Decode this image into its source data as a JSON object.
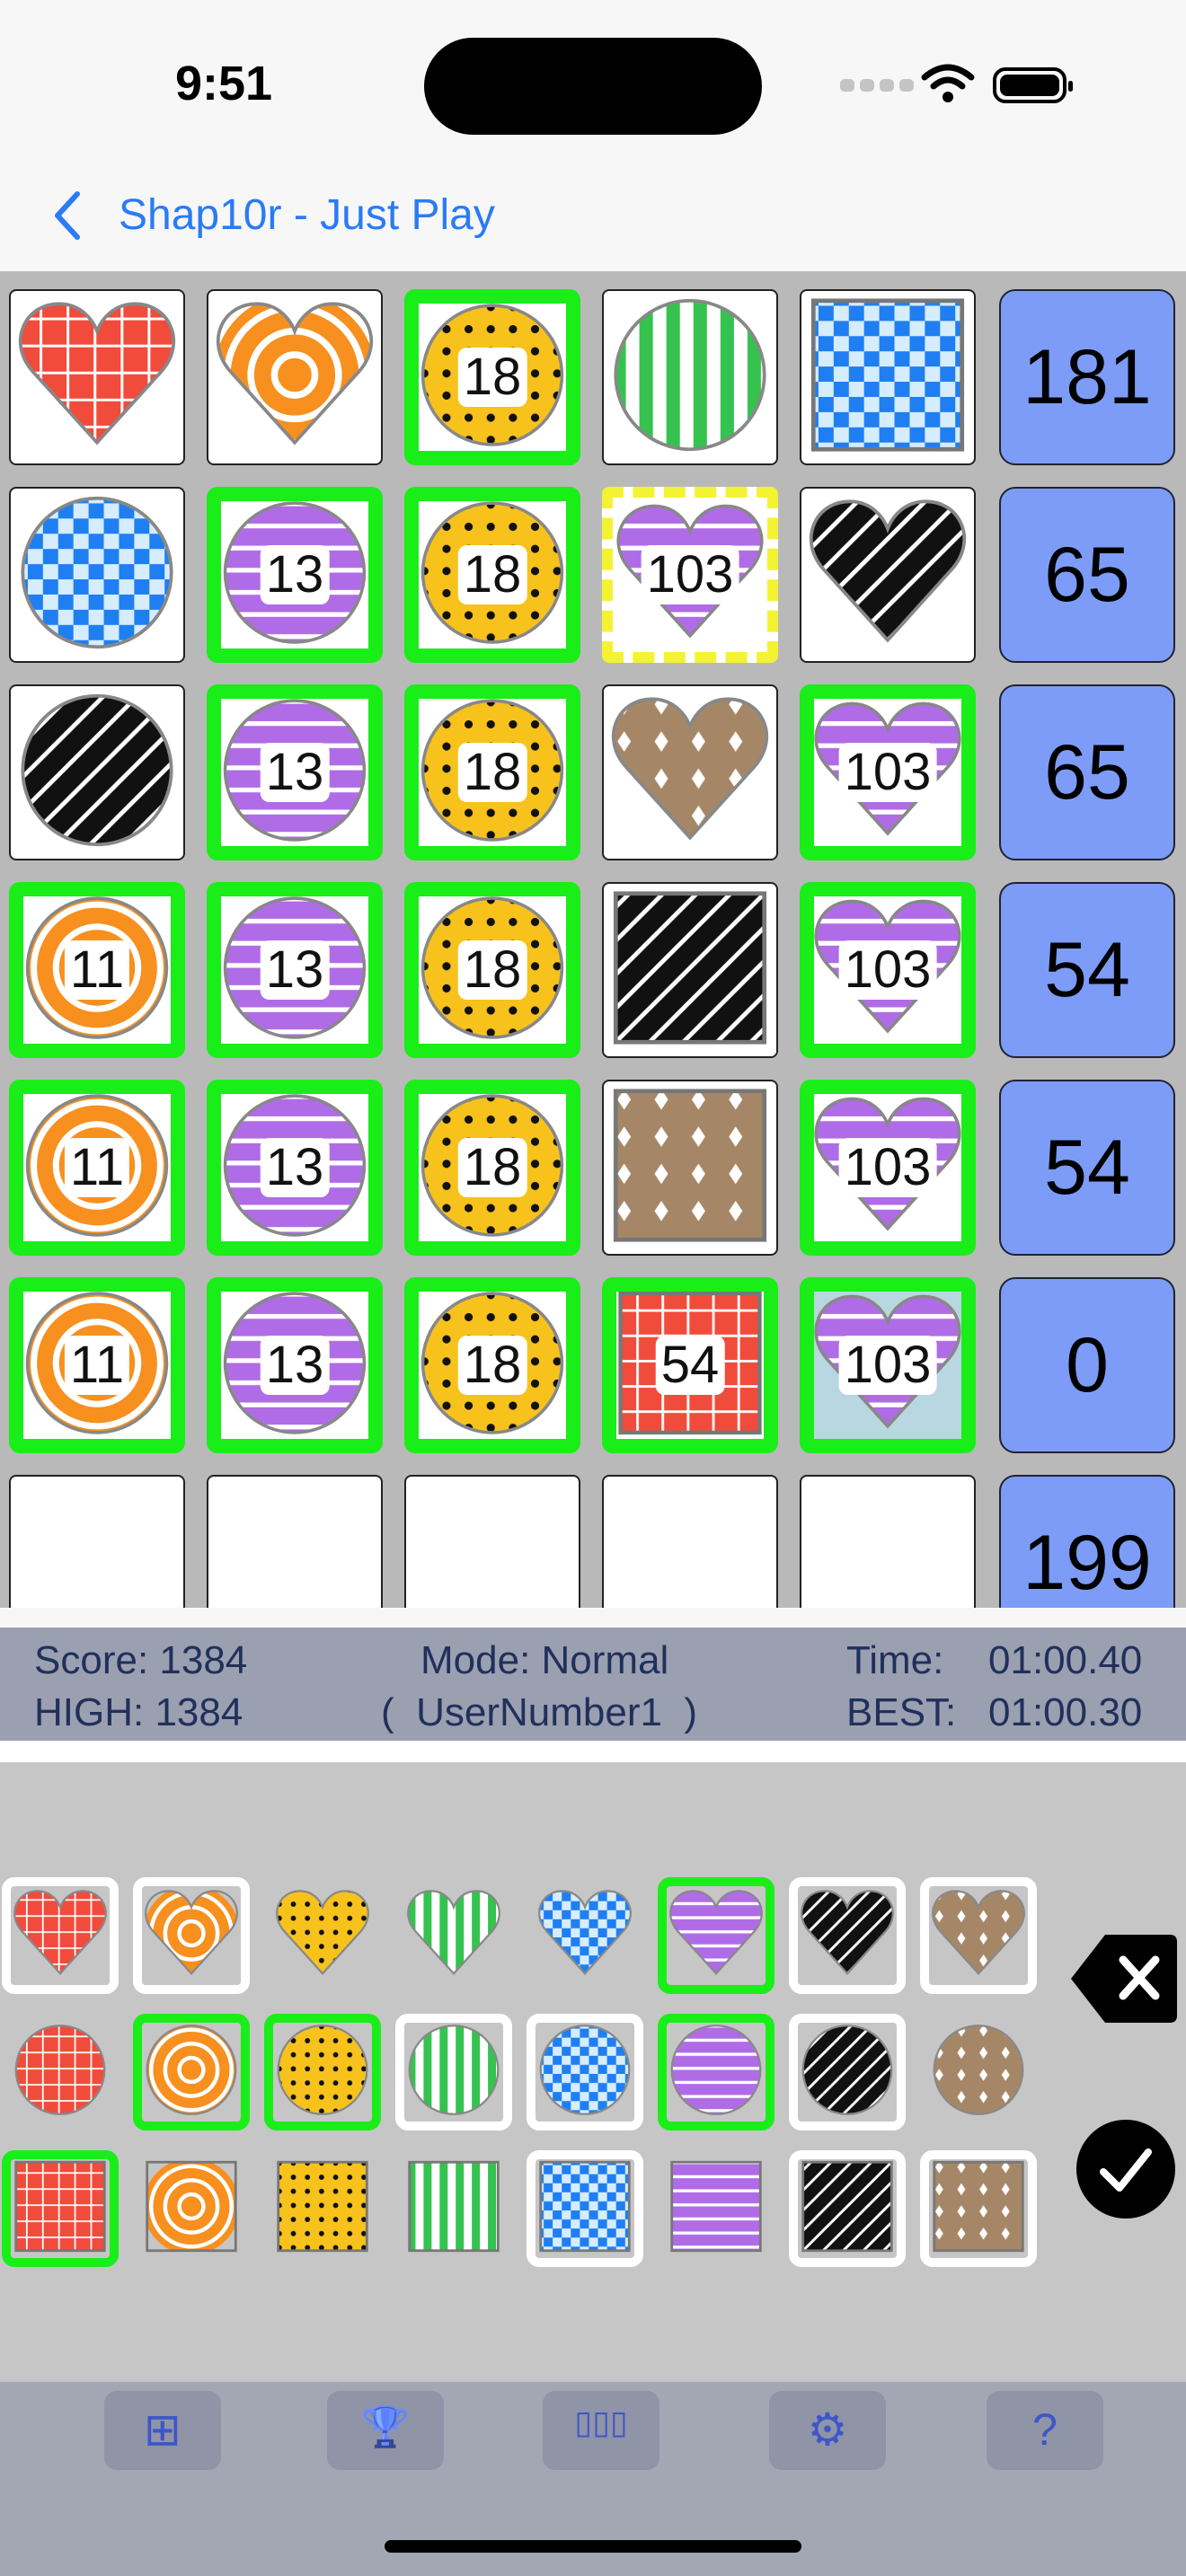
{
  "status_bar": {
    "time": "9:51",
    "icons": [
      "signal-icon",
      "wifi-icon",
      "battery-icon"
    ]
  },
  "nav": {
    "back_icon": "chevron-left-icon",
    "title": "Shap10r - Just Play"
  },
  "colors": {
    "red": "#f14b3c",
    "orange": "#f7901e",
    "yellow": "#f8c21c",
    "green": "#35c24f",
    "blue": "#1f7ff2",
    "purple": "#b06ce6",
    "black": "#111111",
    "brown": "#a58767",
    "highlight_green": "#19ee19",
    "highlight_yellow": "#f3f334",
    "sum_blue": "#7c9cf7"
  },
  "board": {
    "rows": [
      {
        "cells": [
          {
            "shape": "heart",
            "color": "red",
            "pattern": "grid"
          },
          {
            "shape": "heart",
            "color": "orange",
            "pattern": "rings"
          },
          {
            "shape": "circle",
            "color": "yellow",
            "pattern": "dots",
            "num": "18",
            "hl": "green"
          },
          {
            "shape": "circle",
            "color": "green",
            "pattern": "vstripes"
          },
          {
            "shape": "square",
            "color": "blue",
            "pattern": "checker"
          }
        ],
        "sum": "181"
      },
      {
        "cells": [
          {
            "shape": "circle",
            "color": "blue",
            "pattern": "checker"
          },
          {
            "shape": "circle",
            "color": "purple",
            "pattern": "hstripes",
            "num": "13",
            "hl": "green"
          },
          {
            "shape": "circle",
            "color": "yellow",
            "pattern": "dots",
            "num": "18",
            "hl": "green"
          },
          {
            "shape": "heart",
            "color": "purple",
            "pattern": "hstripes",
            "num": "103",
            "hl": "yellow"
          },
          {
            "shape": "heart",
            "color": "black",
            "pattern": "diag"
          }
        ],
        "sum": "65"
      },
      {
        "cells": [
          {
            "shape": "circle",
            "color": "black",
            "pattern": "diag"
          },
          {
            "shape": "circle",
            "color": "purple",
            "pattern": "hstripes",
            "num": "13",
            "hl": "green"
          },
          {
            "shape": "circle",
            "color": "yellow",
            "pattern": "dots",
            "num": "18",
            "hl": "green"
          },
          {
            "shape": "heart",
            "color": "brown",
            "pattern": "diamonds"
          },
          {
            "shape": "heart",
            "color": "purple",
            "pattern": "hstripes",
            "num": "103",
            "hl": "green"
          }
        ],
        "sum": "65"
      },
      {
        "cells": [
          {
            "shape": "circle",
            "color": "orange",
            "pattern": "rings",
            "num": "11",
            "hl": "green"
          },
          {
            "shape": "circle",
            "color": "purple",
            "pattern": "hstripes",
            "num": "13",
            "hl": "green"
          },
          {
            "shape": "circle",
            "color": "yellow",
            "pattern": "dots",
            "num": "18",
            "hl": "green"
          },
          {
            "shape": "square",
            "color": "black",
            "pattern": "diag"
          },
          {
            "shape": "heart",
            "color": "purple",
            "pattern": "hstripes",
            "num": "103",
            "hl": "green"
          }
        ],
        "sum": "54"
      },
      {
        "cells": [
          {
            "shape": "circle",
            "color": "orange",
            "pattern": "rings",
            "num": "11",
            "hl": "green"
          },
          {
            "shape": "circle",
            "color": "purple",
            "pattern": "hstripes",
            "num": "13",
            "hl": "green"
          },
          {
            "shape": "circle",
            "color": "yellow",
            "pattern": "dots",
            "num": "18",
            "hl": "green"
          },
          {
            "shape": "square",
            "color": "brown",
            "pattern": "diamonds"
          },
          {
            "shape": "heart",
            "color": "purple",
            "pattern": "hstripes",
            "num": "103",
            "hl": "green"
          }
        ],
        "sum": "54"
      },
      {
        "cells": [
          {
            "shape": "circle",
            "color": "orange",
            "pattern": "rings",
            "num": "11",
            "hl": "green"
          },
          {
            "shape": "circle",
            "color": "purple",
            "pattern": "hstripes",
            "num": "13",
            "hl": "green"
          },
          {
            "shape": "circle",
            "color": "yellow",
            "pattern": "dots",
            "num": "18",
            "hl": "green"
          },
          {
            "shape": "square",
            "color": "red",
            "pattern": "grid",
            "num": "54",
            "hl": "green"
          },
          {
            "shape": "heart",
            "color": "purple",
            "pattern": "hstripes",
            "num": "103",
            "hl": "green",
            "bg": "lightblue"
          }
        ],
        "sum": "0"
      },
      {
        "cells": [
          {
            "shape": "empty"
          },
          {
            "shape": "empty"
          },
          {
            "shape": "empty"
          },
          {
            "shape": "empty"
          },
          {
            "shape": "empty"
          }
        ],
        "sum": "199"
      }
    ]
  },
  "score_panel": {
    "score": "Score: 1384",
    "high": "HIGH: 1384",
    "mode": "Mode: Normal",
    "user": "(  UserNumber1  )",
    "time_label": "Time:",
    "time_value": "01:00.40",
    "best_label": "BEST:",
    "best_value": "01:00.30"
  },
  "palette": {
    "rows": [
      {
        "shape": "heart",
        "items": [
          {
            "color": "red",
            "pattern": "grid",
            "frame": "white"
          },
          {
            "color": "orange",
            "pattern": "rings",
            "frame": "white"
          },
          {
            "color": "yellow",
            "pattern": "dots",
            "frame": "none"
          },
          {
            "color": "green",
            "pattern": "vstripes",
            "frame": "none"
          },
          {
            "color": "blue",
            "pattern": "checker",
            "frame": "none"
          },
          {
            "color": "purple",
            "pattern": "hstripes",
            "frame": "green"
          },
          {
            "color": "black",
            "pattern": "diag",
            "frame": "white"
          },
          {
            "color": "brown",
            "pattern": "diamonds",
            "frame": "white"
          }
        ]
      },
      {
        "shape": "circle",
        "items": [
          {
            "color": "red",
            "pattern": "grid",
            "frame": "none"
          },
          {
            "color": "orange",
            "pattern": "rings",
            "frame": "green"
          },
          {
            "color": "yellow",
            "pattern": "dots",
            "frame": "green"
          },
          {
            "color": "green",
            "pattern": "vstripes",
            "frame": "white"
          },
          {
            "color": "blue",
            "pattern": "checker",
            "frame": "white"
          },
          {
            "color": "purple",
            "pattern": "hstripes",
            "frame": "green"
          },
          {
            "color": "black",
            "pattern": "diag",
            "frame": "white"
          },
          {
            "color": "brown",
            "pattern": "diamonds",
            "frame": "none"
          }
        ]
      },
      {
        "shape": "square",
        "items": [
          {
            "color": "red",
            "pattern": "grid",
            "frame": "green"
          },
          {
            "color": "orange",
            "pattern": "rings",
            "frame": "none"
          },
          {
            "color": "yellow",
            "pattern": "dots",
            "frame": "none"
          },
          {
            "color": "green",
            "pattern": "vstripes",
            "frame": "none"
          },
          {
            "color": "blue",
            "pattern": "checker",
            "frame": "white"
          },
          {
            "color": "purple",
            "pattern": "hstripes",
            "frame": "none"
          },
          {
            "color": "black",
            "pattern": "diag",
            "frame": "white"
          },
          {
            "color": "brown",
            "pattern": "diamonds",
            "frame": "white"
          }
        ]
      }
    ],
    "delete_icon": "delete-backspace-icon",
    "confirm_icon": "checkmark-icon"
  },
  "toolbar": {
    "buttons": [
      {
        "name": "new-game-button",
        "icon": "plus-square-icon",
        "glyph": "⊞"
      },
      {
        "name": "trophy-button",
        "icon": "trophy-icon",
        "glyph": "🏆"
      },
      {
        "name": "stats-button",
        "icon": "bar-chart-icon",
        "glyph": "▯▯▯"
      },
      {
        "name": "settings-button",
        "icon": "gear-icon",
        "glyph": "⚙"
      },
      {
        "name": "help-button",
        "icon": "question-icon",
        "glyph": "?"
      }
    ]
  }
}
